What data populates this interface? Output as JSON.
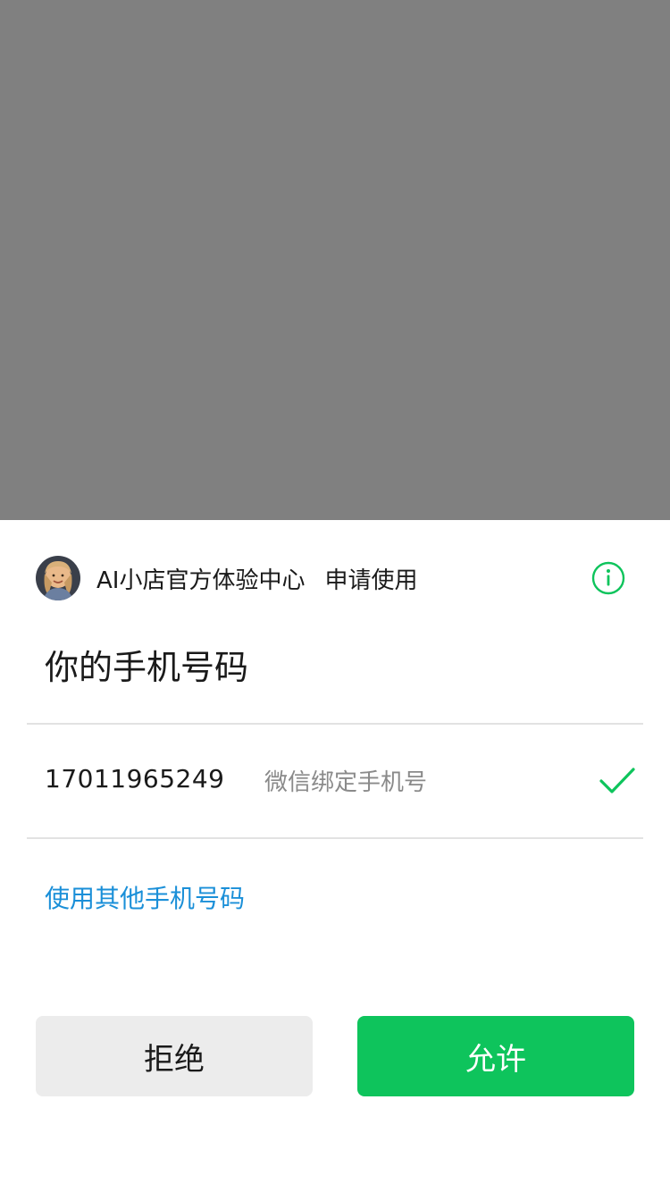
{
  "header": {
    "app_name": "AI小店官方体验中心",
    "action": "申请使用"
  },
  "title": "你的手机号码",
  "phone_option": {
    "number": "17011965249",
    "description": "微信绑定手机号",
    "selected": true
  },
  "other_phone_link": "使用其他手机号码",
  "buttons": {
    "deny": "拒绝",
    "allow": "允许"
  },
  "colors": {
    "accent_green": "#0ec45c",
    "link_blue": "#1a8fd8",
    "overlay_gray": "#808080"
  },
  "icons": [
    "avatar",
    "info-icon",
    "check-icon"
  ]
}
